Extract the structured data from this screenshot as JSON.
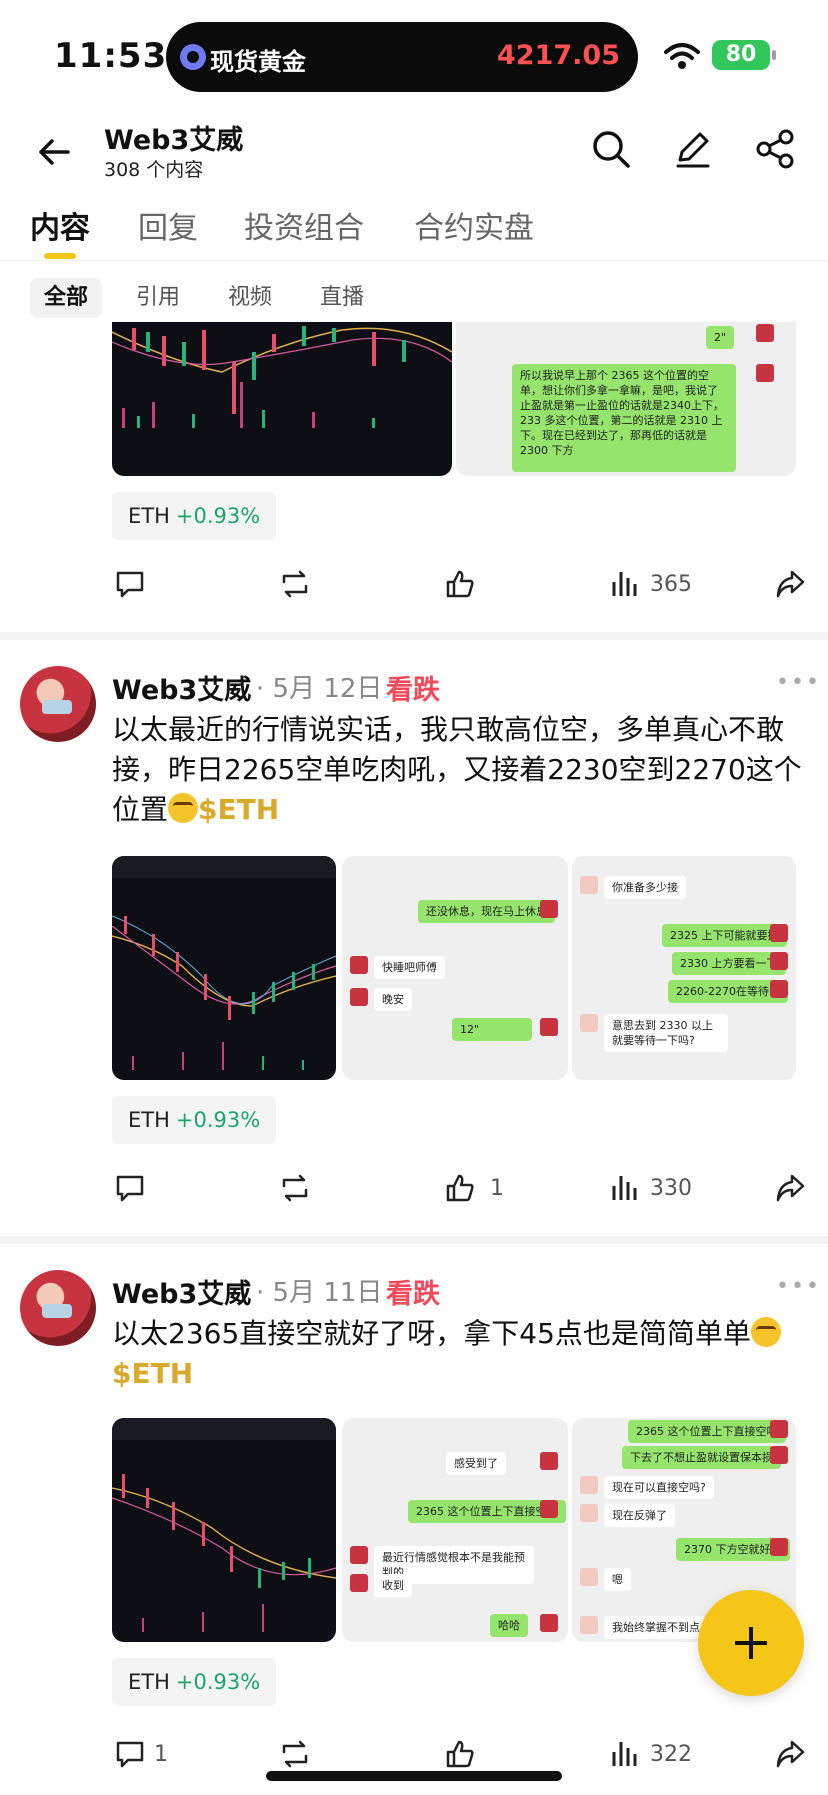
{
  "status": {
    "time": "11:53",
    "ticker_label": "现货黄金",
    "ticker_value": "4217.05",
    "battery": "80"
  },
  "header": {
    "title": "Web3艾威",
    "subtitle": "308 个内容"
  },
  "tabs": [
    "内容",
    "回复",
    "投资组合",
    "合约实盘"
  ],
  "chips": [
    "全部",
    "引用",
    "视频",
    "直播"
  ],
  "posts": [
    {
      "tag": {
        "symbol": "ETH",
        "change": "+0.93%"
      },
      "stats": {
        "likes": "",
        "views": "365"
      },
      "chat_snippet": "所以我说早上那个 2365 这个位置的空单，想让你们多拿一拿嘛，是吧，我说了止盈就是第一止盈位的话就是2340上下，233 多这个位置，第二的话就是 2310 上下。现在已经到达了，那再低的话就是 2300 下方",
      "voice": "2\""
    },
    {
      "author": "Web3艾威",
      "date": "· 5月 12日",
      "sentiment": "看跌",
      "text": "以太最近的行情说实话，我只敢高位空，多单真心不敢接，昨日2265空单吃肉吼，又接着2230空到2270这个位置",
      "cashtag": "$ETH",
      "tag": {
        "symbol": "ETH",
        "change": "+0.93%"
      },
      "stats": {
        "likes": "1",
        "views": "330"
      },
      "chat1": [
        "还没休息，现在马上休息",
        "快睡吧师傅",
        "晚安",
        "12\""
      ],
      "chat2": [
        "你准备多少接",
        "2325 上下可能就要接",
        "2330 上方要看一下",
        "2260-2270在等待了",
        "意思去到 2330 以上就要等待一下吗?"
      ]
    },
    {
      "author": "Web3艾威",
      "date": "· 5月 11日",
      "sentiment": "看跌",
      "text": "以太2365直接空就好了呀，拿下45点也是简简单单",
      "cashtag": "$ETH",
      "tag": {
        "symbol": "ETH",
        "change": "+0.93%"
      },
      "stats": {
        "comments": "1",
        "views": "322"
      },
      "chat1": [
        "感受到了",
        "2365 这个位置上下直接空吧",
        "最近行情感觉根本不是我能预判的",
        "收到",
        "哈哈"
      ],
      "chat2": [
        "2365 这个位置上下直接空吧",
        "下去了不想止盈就设置保本损",
        "现在可以直接空吗?",
        "现在反弹了",
        "2370 下方空就好了",
        "嗯",
        "我始终掌握不到点"
      ]
    }
  ],
  "icons": {
    "comment": "comment-icon",
    "repost": "repost-icon",
    "like": "like-icon",
    "views": "views-icon",
    "share": "share-icon"
  },
  "colors": {
    "accent": "#f5c518",
    "bear": "#f04a5b",
    "bull": "#1ba46e",
    "cashtag": "#d9a92c"
  }
}
